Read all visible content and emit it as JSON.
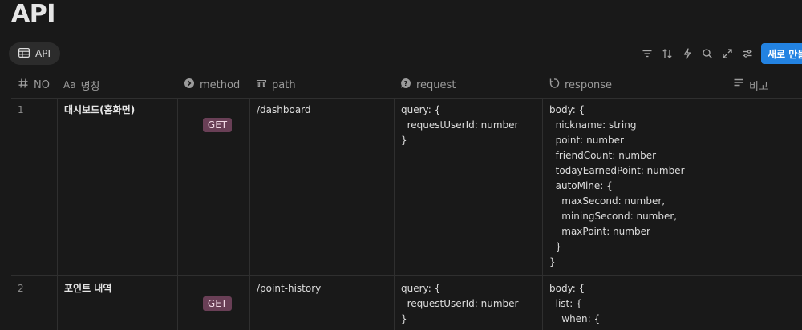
{
  "page": {
    "title": "API"
  },
  "view": {
    "tab_label": "API",
    "icon": "table-icon"
  },
  "toolbar": {
    "icons": [
      "filter-icon",
      "sort-icon",
      "automation-icon",
      "search-icon",
      "expand-icon",
      "settings-icon"
    ],
    "new_label": "새로 만들기"
  },
  "columns": [
    {
      "label": "NO",
      "icon": "number-icon"
    },
    {
      "label": "명칭",
      "icon": "title-text-icon"
    },
    {
      "label": "method",
      "icon": "select-icon"
    },
    {
      "label": "path",
      "icon": "url-icon"
    },
    {
      "label": "request",
      "icon": "help-icon"
    },
    {
      "label": "response",
      "icon": "rotate-icon"
    },
    {
      "label": "비고",
      "icon": "text-icon"
    }
  ],
  "rows": [
    {
      "no": "1",
      "name": "대시보드(홈화면)",
      "method": "GET",
      "path": "/dashboard",
      "request": "query: {\n  requestUserId: number\n}",
      "response": "body: {\n  nickname: string\n  point: number\n  friendCount: number\n  todayEarnedPoint: number\n  autoMine: {\n    maxSecond: number,\n    miningSecond: number,\n    maxPoint: number\n  }\n}",
      "note": ""
    },
    {
      "no": "2",
      "name": "포인트 내역",
      "method": "GET",
      "path": "/point-history",
      "request": "query: {\n  requestUserId: number\n}",
      "response": "body: {\n  list: {\n    when: {",
      "note": ""
    }
  ],
  "colors": {
    "badge_bg": "#693f56",
    "accent": "#2383e2",
    "background": "#191919"
  }
}
